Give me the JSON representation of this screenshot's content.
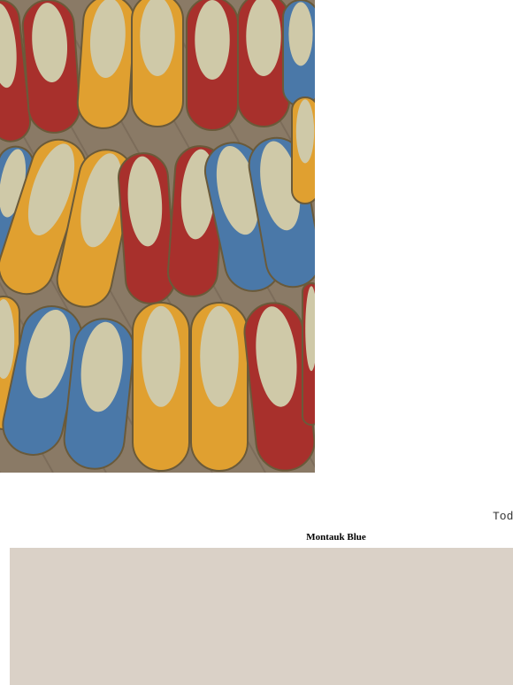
{
  "hero_image": {
    "alt": "",
    "shoe_colors": {
      "red": "#a8302c",
      "mustard": "#e0a030",
      "blue": "#4a78a8",
      "lining": "#cfc9a8",
      "floor": "#8a7a66"
    }
  },
  "today_label": "Toda",
  "product": {
    "title": "Montauk Blue"
  },
  "swatch_panel": {
    "color": "#dad1c7"
  }
}
